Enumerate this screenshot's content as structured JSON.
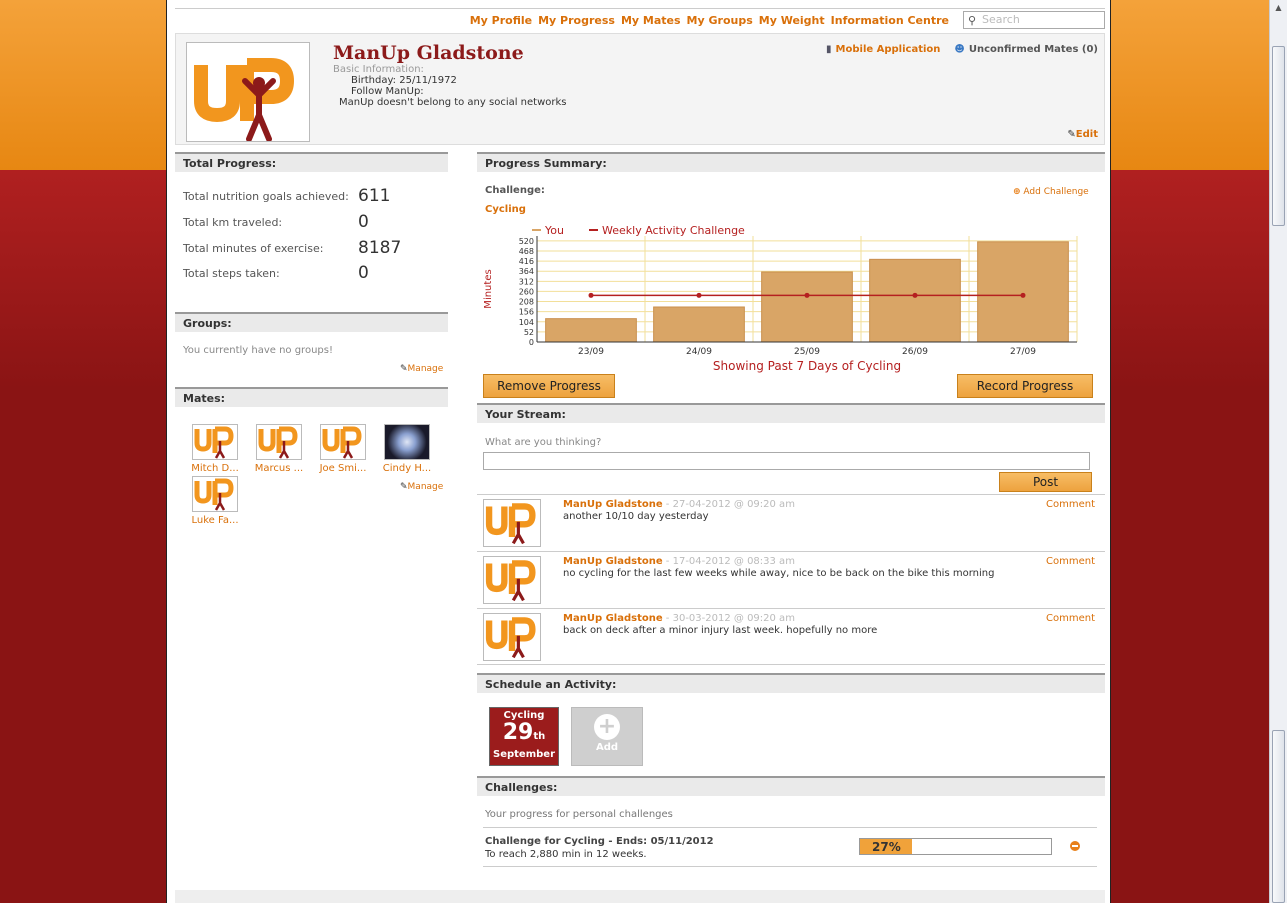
{
  "nav": {
    "items": [
      "My Profile",
      "My Progress",
      "My Mates",
      "My Groups",
      "My Weight",
      "Information Centre"
    ],
    "search_placeholder": "Search"
  },
  "profile": {
    "name": "ManUp Gladstone",
    "basic_info_label": "Basic Information:",
    "birthday_label": "Birthday:",
    "birthday": "25/11/1972",
    "follow_label": "Follow ManUp:",
    "networks_text": "ManUp doesn't belong to any social networks",
    "mobile_app": "Mobile Application",
    "unconfirmed_mates": "Unconfirmed Mates (0)",
    "edit": "Edit"
  },
  "total_progress": {
    "heading": "Total Progress:",
    "stats": [
      {
        "label": "Total nutrition goals achieved:",
        "value": "611"
      },
      {
        "label": "Total km traveled:",
        "value": "0"
      },
      {
        "label": "Total minutes of exercise:",
        "value": "8187"
      },
      {
        "label": "Total steps taken:",
        "value": "0"
      }
    ]
  },
  "groups": {
    "heading": "Groups:",
    "empty_text": "You currently have no groups!",
    "manage": "Manage"
  },
  "mates": {
    "heading": "Mates:",
    "list": [
      "Mitch D...",
      "Marcus ...",
      "Joe Smi...",
      "Cindy H...",
      "Luke Fa..."
    ],
    "manage": "Manage"
  },
  "progress_summary": {
    "heading": "Progress Summary:",
    "challenge_label": "Challenge:",
    "challenge_name": "Cycling",
    "add_challenge": "Add Challenge",
    "remove_button": "Remove Progress",
    "record_button": "Record Progress"
  },
  "chart_data": {
    "type": "bar",
    "categories": [
      "23/09",
      "24/09",
      "25/09",
      "26/09",
      "27/09"
    ],
    "series": [
      {
        "name": "You",
        "type": "bar",
        "values": [
          120,
          180,
          360,
          425,
          515
        ]
      },
      {
        "name": "Weekly Activity Challenge",
        "type": "line",
        "values": [
          240,
          240,
          240,
          240,
          240
        ]
      }
    ],
    "ylabel": "Minutes",
    "xlabel": "Showing Past 7 Days of Cycling",
    "yticks": [
      0,
      52,
      104,
      156,
      208,
      260,
      312,
      364,
      416,
      468,
      520
    ],
    "ylim": [
      0,
      545
    ],
    "legend": "top-left",
    "colors": {
      "bar": "#d9a566",
      "line": "#b52020"
    }
  },
  "stream": {
    "heading": "Your Stream:",
    "prompt": "What are you thinking?",
    "post_button": "Post",
    "posts": [
      {
        "author": "ManUp Gladstone",
        "time": " - 27-04-2012 @ 09:20 am",
        "text": "another 10/10 day yesterday",
        "comment": "Comment"
      },
      {
        "author": "ManUp Gladstone",
        "time": " - 17-04-2012 @ 08:33 am",
        "text": "no cycling for the last few weeks while away, nice to be back on the bike this morning",
        "comment": "Comment"
      },
      {
        "author": "ManUp Gladstone",
        "time": " - 30-03-2012 @ 09:20 am",
        "text": "back on deck after a minor injury last week. hopefully no more",
        "comment": "Comment"
      }
    ]
  },
  "schedule": {
    "heading": "Schedule an Activity:",
    "activity": "Cycling",
    "day": "29",
    "suffix": "th",
    "month": "September",
    "add_label": "Add"
  },
  "challenges": {
    "heading": "Challenges:",
    "subtitle": "Your progress for personal challenges",
    "title": "Challenge for Cycling - Ends: 05/11/2012",
    "desc": "To reach 2,880 min in 12 weeks.",
    "progress_label": "27%",
    "progress": 0.27
  }
}
